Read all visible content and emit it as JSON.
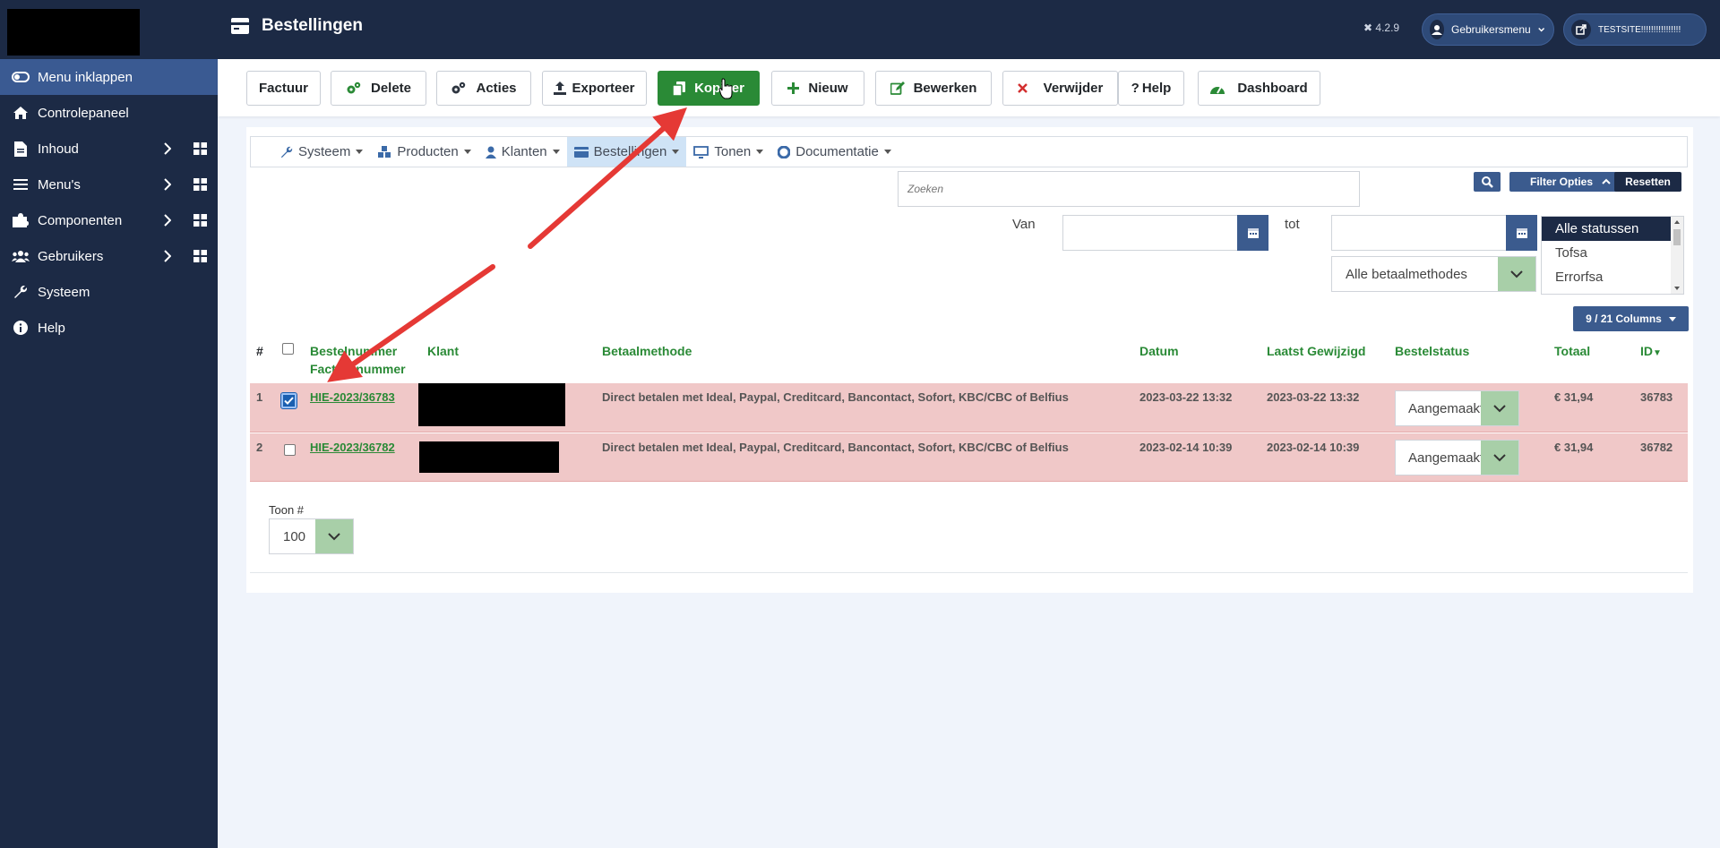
{
  "header": {
    "title": "Bestellingen",
    "version": "4.2.9",
    "user_menu_label": "Gebruikersmenu",
    "site_label": "TESTSITE!!!!!!!!!!!!!!!!"
  },
  "sidebar": {
    "items": [
      {
        "label": "Menu inklappen",
        "icon": "toggle-icon"
      },
      {
        "label": "Controlepaneel",
        "icon": "home-icon"
      },
      {
        "label": "Inhoud",
        "icon": "file-icon"
      },
      {
        "label": "Menu's",
        "icon": "list-icon"
      },
      {
        "label": "Componenten",
        "icon": "puzzle-icon"
      },
      {
        "label": "Gebruikers",
        "icon": "users-icon"
      },
      {
        "label": "Systeem",
        "icon": "wrench-icon"
      },
      {
        "label": "Help",
        "icon": "info-icon"
      }
    ]
  },
  "toolbar": {
    "factuur": "Factuur",
    "delete": "Delete",
    "acties": "Acties",
    "exporteer": "Exporteer",
    "kopieer": "Kopieer",
    "nieuw": "Nieuw",
    "bewerken": "Bewerken",
    "verwijder": "Verwijder",
    "help": "Help",
    "dashboard": "Dashboard"
  },
  "subnav": {
    "systeem": "Systeem",
    "producten": "Producten",
    "klanten": "Klanten",
    "bestellingen": "Bestellingen",
    "tonen": "Tonen",
    "documentatie": "Documentatie"
  },
  "filters": {
    "search_placeholder": "Zoeken",
    "filter_options": "Filter Opties",
    "reset": "Resetten",
    "van": "Van",
    "tot": "tot",
    "payment_method": "Alle betaalmethodes",
    "status_options": [
      "Alle statussen",
      "Tofsa",
      "Errorfsa"
    ],
    "columns": "9 / 21  Columns"
  },
  "table": {
    "headers": {
      "num": "#",
      "order_number": "Bestelnummer",
      "invoice_number": "Factuurnummer",
      "klant": "Klant",
      "betaalmethode": "Betaalmethode",
      "datum": "Datum",
      "gewijzigd": "Laatst Gewijzigd",
      "status": "Bestelstatus",
      "totaal": "Totaal",
      "id": "ID"
    },
    "rows": [
      {
        "num": "1",
        "order": "HIE-2023/36783",
        "payment": "Direct betalen met Ideal, Paypal, Creditcard, Bancontact, Sofort, KBC/CBC of Belfius",
        "date": "2023-03-22 13:32",
        "modified": "2023-03-22 13:32",
        "status": "Aangemaakt",
        "total": "€ 31,94",
        "id": "36783",
        "checked": true
      },
      {
        "num": "2",
        "order": "HIE-2023/36782",
        "payment": "Direct betalen met Ideal, Paypal, Creditcard, Bancontact, Sofort, KBC/CBC of Belfius",
        "date": "2023-02-14 10:39",
        "modified": "2023-02-14 10:39",
        "status": "Aangemaakt",
        "total": "€ 31,94",
        "id": "36782",
        "checked": false
      }
    ]
  },
  "pagination": {
    "label": "Toon #",
    "limit": "100"
  },
  "colors": {
    "navy": "#1c2a45",
    "green": "#2a8a36",
    "row_highlight": "#f0c8c8",
    "annotation_arrow": "#e53935"
  }
}
